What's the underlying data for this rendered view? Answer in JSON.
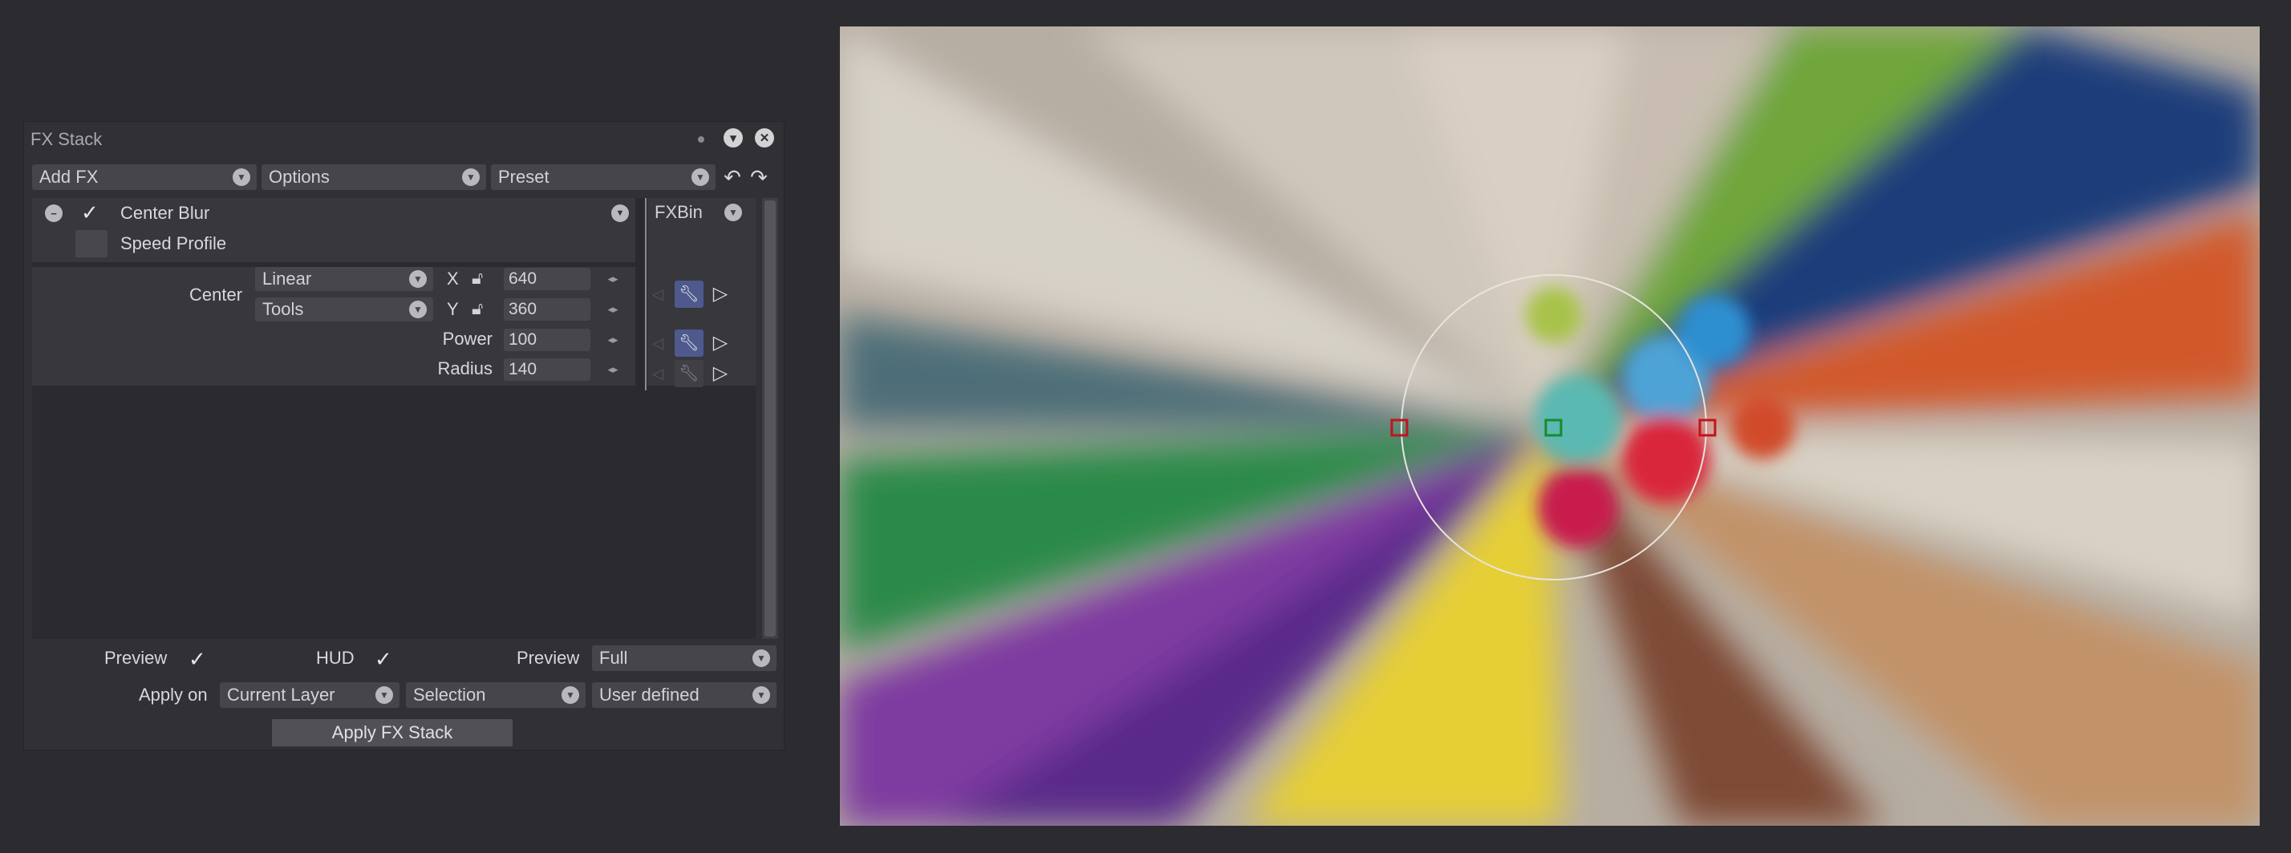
{
  "panel": {
    "title": "FX Stack",
    "add_fx": "Add FX",
    "options": "Options",
    "preset": "Preset",
    "fx": {
      "name": "Center Blur",
      "speed_profile": "Speed Profile",
      "fxbin": "FXBin"
    },
    "params": {
      "center_label": "Center",
      "center_mode": "Linear",
      "center_tools": "Tools",
      "x_label": "X",
      "y_label": "Y",
      "x_value": "640",
      "y_value": "360",
      "power_label": "Power",
      "power_value": "100",
      "radius_label": "Radius",
      "radius_value": "140"
    },
    "footer": {
      "preview_label": "Preview",
      "hud_label": "HUD",
      "preview2_label": "Preview",
      "preview_mode": "Full",
      "apply_on_label": "Apply on",
      "apply_on_value": "Current Layer",
      "selection_value": "Selection",
      "user_defined_value": "User defined",
      "apply_button": "Apply FX Stack"
    }
  },
  "colors": {
    "background": "#2b2b30",
    "panel": "#303035",
    "active_key_button": "#4e5a8e",
    "hud_handle_side": "#c0141e",
    "hud_handle_center": "#1a8a2a"
  },
  "icons": [
    "undo-icon",
    "redo-icon",
    "collapse-icon",
    "close-icon",
    "lock-icon",
    "wrench-icon",
    "keyframe-next-icon",
    "checkmark-icon",
    "chevron-down-icon"
  ]
}
